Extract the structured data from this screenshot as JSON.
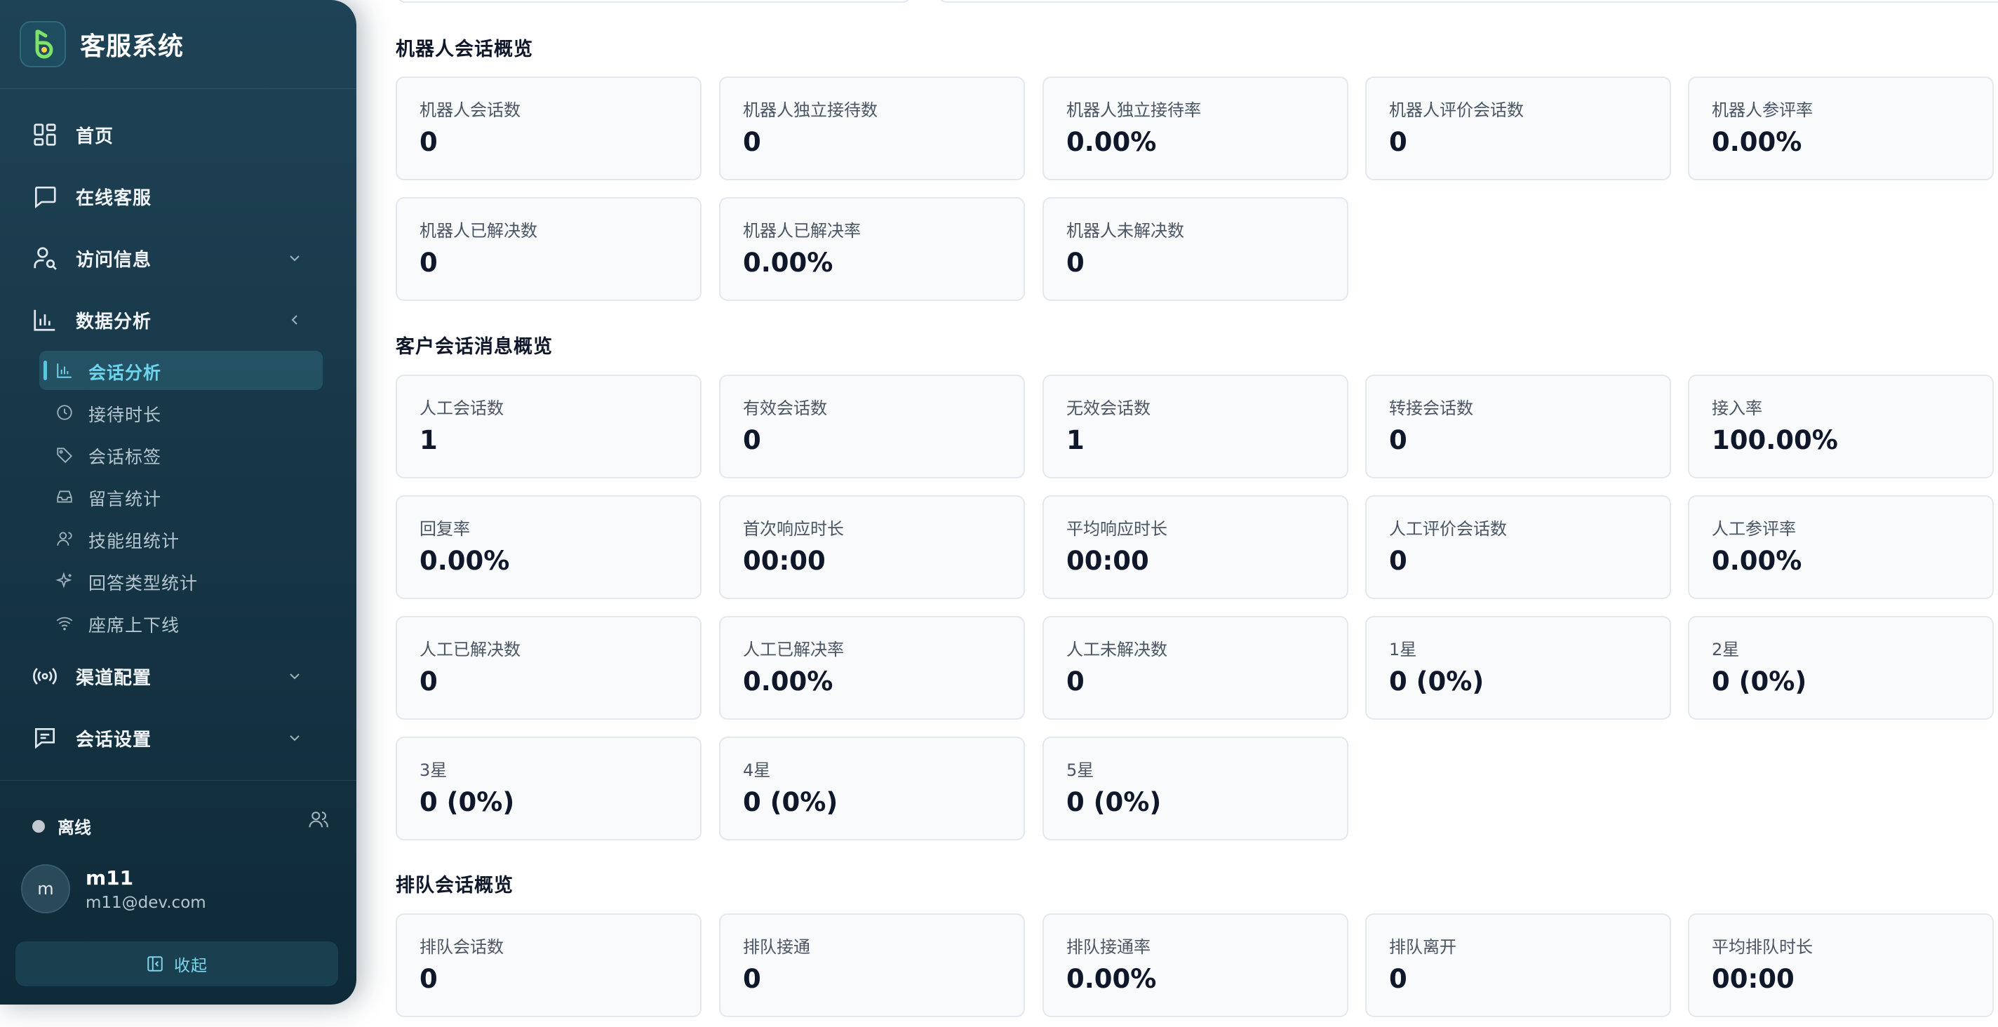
{
  "app": {
    "title": "客服系统"
  },
  "sidebar": {
    "nav": [
      {
        "label": "首页"
      },
      {
        "label": "在线客服"
      },
      {
        "label": "访问信息"
      },
      {
        "label": "数据分析"
      },
      {
        "label": "渠道配置"
      },
      {
        "label": "会话设置"
      }
    ],
    "sub_items": [
      {
        "label": "会话分析",
        "active": true
      },
      {
        "label": "接待时长"
      },
      {
        "label": "会话标签"
      },
      {
        "label": "留言统计"
      },
      {
        "label": "技能组统计"
      },
      {
        "label": "回答类型统计"
      },
      {
        "label": "座席上下线"
      }
    ],
    "status": {
      "label": "离线",
      "color": "#c4c9cf"
    },
    "user": {
      "avatar_letter": "m",
      "name": "m11",
      "email": "m11@dev.com"
    },
    "collapse_label": "收起"
  },
  "colors": {
    "accent": "#6fd3ec",
    "sidebar_bg": "#173747"
  },
  "sections": [
    {
      "title": "机器人会话概览",
      "cards": [
        {
          "label": "机器人会话数",
          "value": "0"
        },
        {
          "label": "机器人独立接待数",
          "value": "0"
        },
        {
          "label": "机器人独立接待率",
          "value": "0.00%"
        },
        {
          "label": "机器人评价会话数",
          "value": "0"
        },
        {
          "label": "机器人参评率",
          "value": "0.00%"
        },
        {
          "label": "机器人已解决数",
          "value": "0"
        },
        {
          "label": "机器人已解决率",
          "value": "0.00%"
        },
        {
          "label": "机器人未解决数",
          "value": "0"
        }
      ]
    },
    {
      "title": "客户会话消息概览",
      "cards": [
        {
          "label": "人工会话数",
          "value": "1"
        },
        {
          "label": "有效会话数",
          "value": "0"
        },
        {
          "label": "无效会话数",
          "value": "1"
        },
        {
          "label": "转接会话数",
          "value": "0"
        },
        {
          "label": "接入率",
          "value": "100.00%"
        },
        {
          "label": "回复率",
          "value": "0.00%"
        },
        {
          "label": "首次响应时长",
          "value": "00:00"
        },
        {
          "label": "平均响应时长",
          "value": "00:00"
        },
        {
          "label": "人工评价会话数",
          "value": "0"
        },
        {
          "label": "人工参评率",
          "value": "0.00%"
        },
        {
          "label": "人工已解决数",
          "value": "0"
        },
        {
          "label": "人工已解决率",
          "value": "0.00%"
        },
        {
          "label": "人工未解决数",
          "value": "0"
        },
        {
          "label": "1星",
          "value": "0 (0%)"
        },
        {
          "label": "2星",
          "value": "0 (0%)"
        },
        {
          "label": "3星",
          "value": "0 (0%)"
        },
        {
          "label": "4星",
          "value": "0 (0%)"
        },
        {
          "label": "5星",
          "value": "0 (0%)"
        }
      ]
    },
    {
      "title": "排队会话概览",
      "cards": [
        {
          "label": "排队会话数",
          "value": "0"
        },
        {
          "label": "排队接通",
          "value": "0"
        },
        {
          "label": "排队接通率",
          "value": "0.00%"
        },
        {
          "label": "排队离开",
          "value": "0"
        },
        {
          "label": "平均排队时长",
          "value": "00:00"
        }
      ]
    }
  ]
}
